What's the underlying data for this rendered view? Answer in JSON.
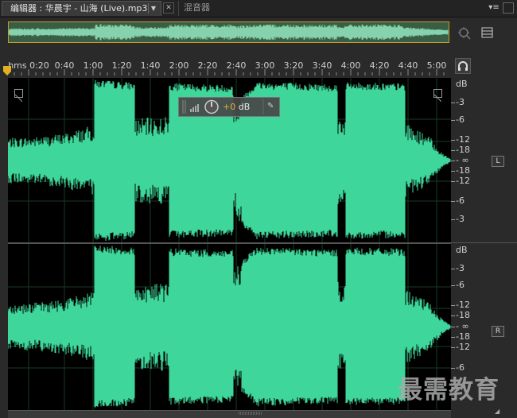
{
  "tabs": {
    "editor_label": "编辑器 : 华晨宇 - 山海 (Live).mp3",
    "editor_dropdown_icon": "chevron-down-icon",
    "close_icon": "close-icon",
    "mixer_label": "混音器"
  },
  "ruler": {
    "ticks": [
      "hms 0:20",
      "0:40",
      "1:00",
      "1:20",
      "1:40",
      "2:00",
      "2:20",
      "2:40",
      "3:00",
      "3:20",
      "3:40",
      "4:00",
      "4:20",
      "4:40",
      "5:00"
    ]
  },
  "hud": {
    "value_prefix": "+0",
    "value_unit": " dB"
  },
  "channels": [
    {
      "button": "L",
      "db_labels": [
        "dB",
        "-3",
        "-6",
        "-12",
        "-18",
        "- ∞",
        "-18",
        "-12",
        "-6",
        "-3"
      ]
    },
    {
      "button": "R",
      "db_labels": [
        "dB",
        "-3",
        "-6",
        "-12",
        "-18",
        "- ∞",
        "-18",
        "-12",
        "-6"
      ]
    }
  ],
  "watermark": "最需教育",
  "colors": {
    "waveform": "#3ed69a",
    "overview_fill": "#8fe0b8",
    "selection_border": "#c99a2a",
    "background": "#000000"
  }
}
